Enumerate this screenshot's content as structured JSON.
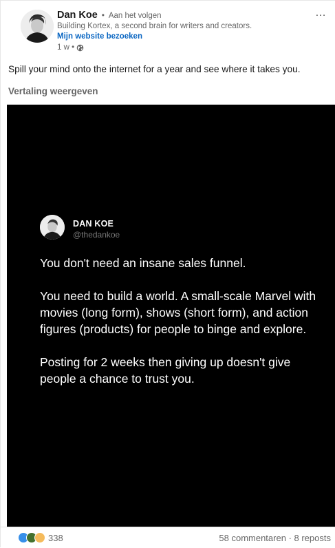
{
  "author": {
    "name": "Dan Koe",
    "separator": "•",
    "follow_status": "Aan het volgen",
    "headline": "Building Kortex, a second brain for writers and creators.",
    "website_link": "Mijn website bezoeken",
    "time": "1 w •",
    "visibility_icon": "globe-icon"
  },
  "more_icon": "more-icon",
  "more_label": "…",
  "post": {
    "text": "Spill your mind onto the internet for a year and see where it takes you.",
    "translate_label": "Vertaling weergeven"
  },
  "image": {
    "name": "DAN KOE",
    "handle": "@thedankoe",
    "paragraphs": [
      "You don't need an insane sales funnel.",
      "You need to build a world. A small-scale Marvel with movies (long form), shows (short form), and action figures (products) for people to binge and explore.",
      "Posting for 2 weeks then giving up doesn't give people a chance to trust you."
    ]
  },
  "social": {
    "reaction_icons": [
      "like-icon",
      "celebrate-icon",
      "support-icon"
    ],
    "reactions_count": "338",
    "comments": "58 commentaren",
    "dot": " · ",
    "reposts": "8 reposts"
  },
  "colors": {
    "link": "#0a66c2",
    "image_bg": "#000000",
    "like": "#378fe9",
    "celebrate": "#44712e",
    "support": "#f5bb5c"
  }
}
